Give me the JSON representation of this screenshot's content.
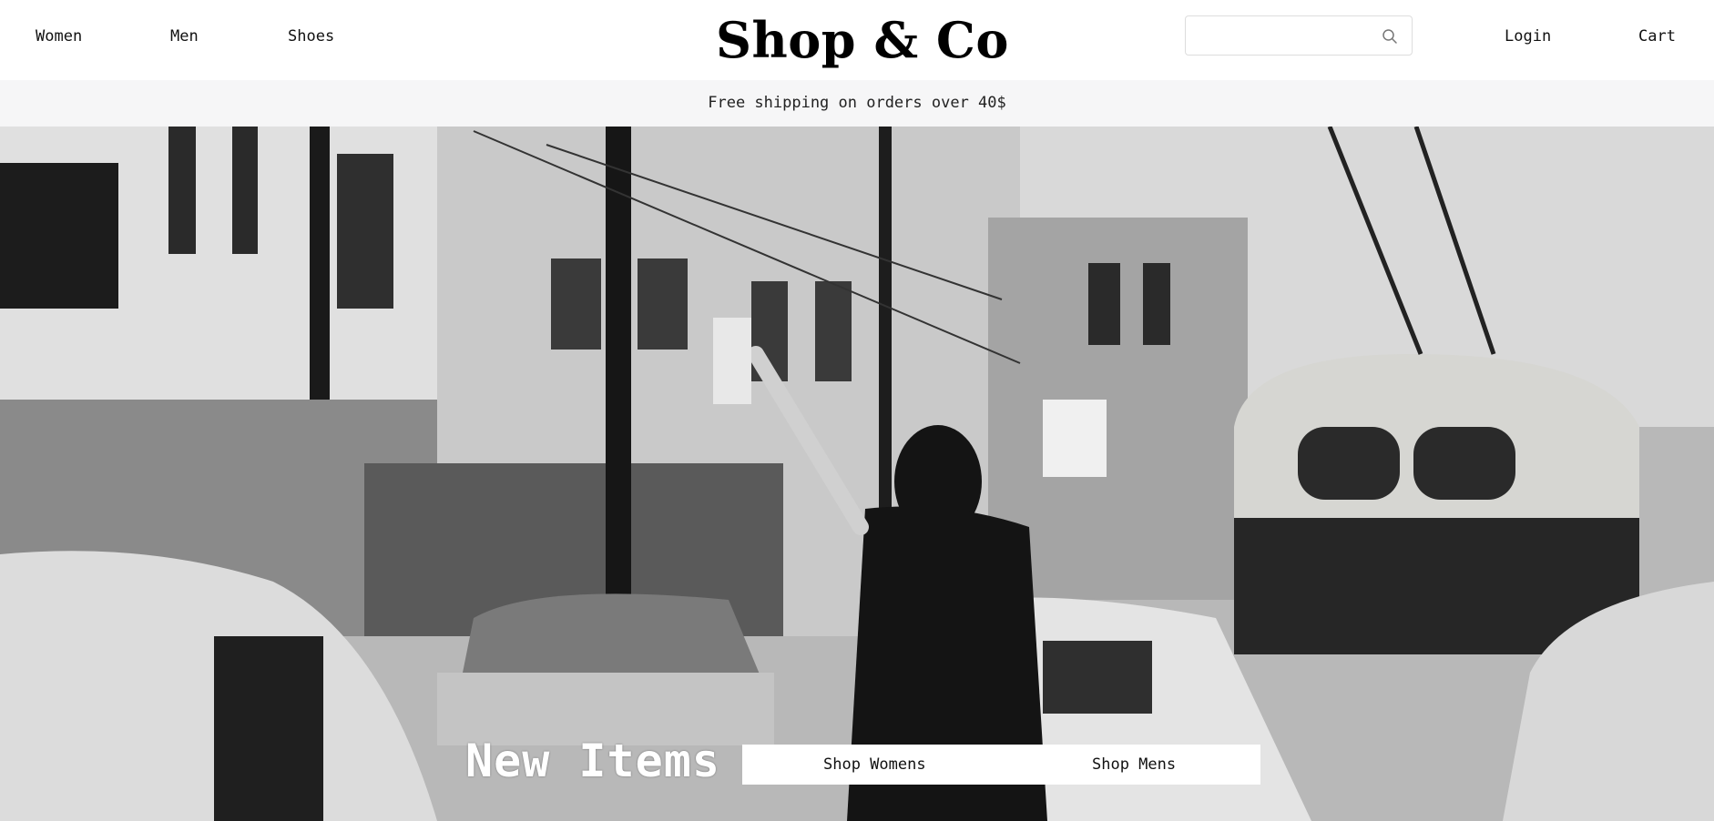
{
  "header": {
    "nav": {
      "women": "Women",
      "men": "Men",
      "shoes": "Shoes"
    },
    "logo": "Shop & Co",
    "search": {
      "placeholder": "",
      "value": "",
      "icon": "search-icon"
    },
    "login": "Login",
    "cart": "Cart"
  },
  "banner": {
    "text": "Free shipping on orders over 40$"
  },
  "hero": {
    "title": "New Items",
    "cta": {
      "shop_womens": "Shop Womens",
      "shop_mens": "Shop Mens"
    }
  }
}
